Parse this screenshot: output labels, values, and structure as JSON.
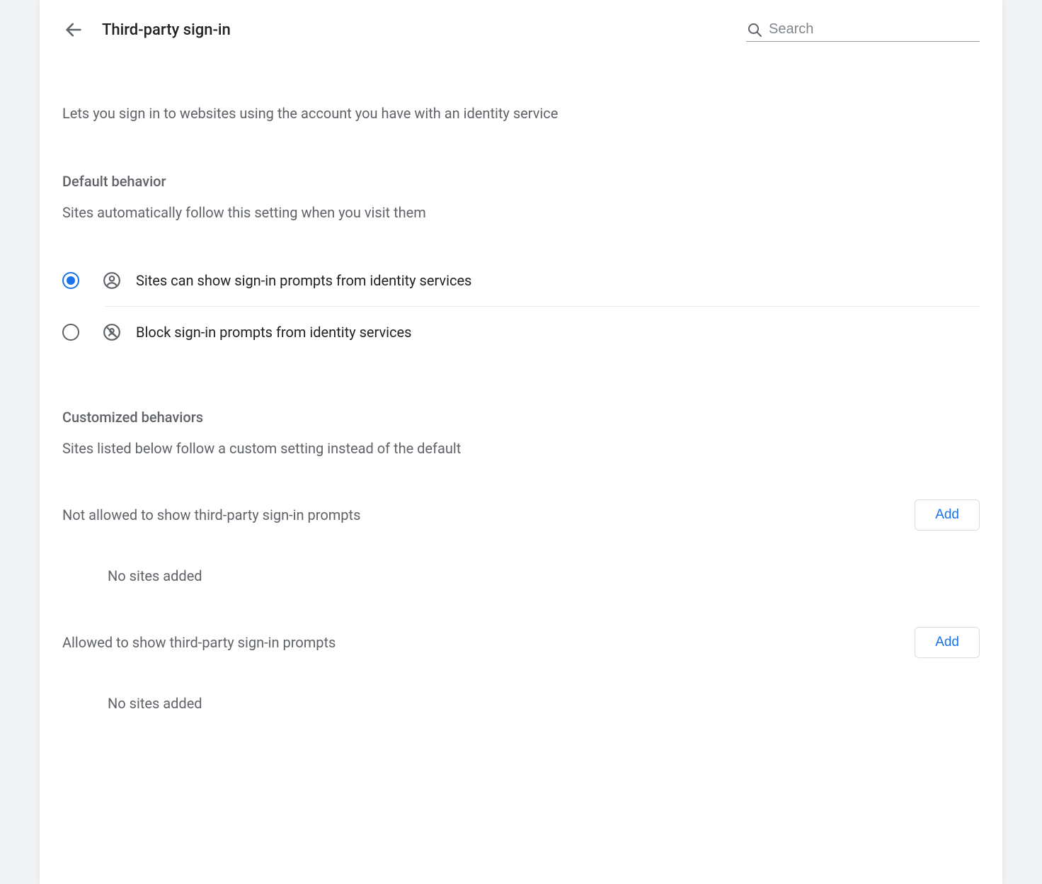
{
  "header": {
    "title": "Third-party sign-in",
    "search_placeholder": "Search"
  },
  "description": "Lets you sign in to websites using the account you have with an identity service",
  "default_section": {
    "title": "Default behavior",
    "subtitle": "Sites automatically follow this setting when you visit them",
    "options": [
      {
        "label": "Sites can show sign-in prompts from identity services",
        "selected": true
      },
      {
        "label": "Block sign-in prompts from identity services",
        "selected": false
      }
    ]
  },
  "custom_section": {
    "title": "Customized behaviors",
    "subtitle": "Sites listed below follow a custom setting instead of the default",
    "lists": [
      {
        "label": "Not allowed to show third-party sign-in prompts",
        "add_label": "Add",
        "empty_text": "No sites added"
      },
      {
        "label": "Allowed to show third-party sign-in prompts",
        "add_label": "Add",
        "empty_text": "No sites added"
      }
    ]
  }
}
